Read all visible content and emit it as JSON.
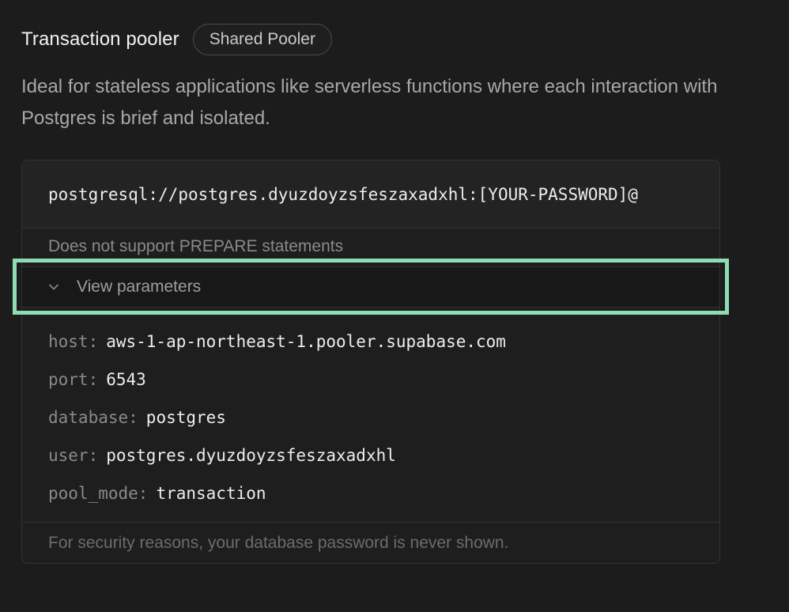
{
  "header": {
    "title": "Transaction pooler",
    "badge": "Shared Pooler"
  },
  "description": "Ideal for stateless applications like serverless functions where each interaction with Postgres is brief and isolated.",
  "connection": {
    "string": "postgresql://postgres.dyuzdoyzsfeszaxadxhl:[YOUR-PASSWORD]@"
  },
  "note": "Does not support PREPARE statements",
  "params_toggle": {
    "label": "View parameters",
    "icon": "chevron-down-icon"
  },
  "params": [
    {
      "key": "host:",
      "value": "aws-1-ap-northeast-1.pooler.supabase.com"
    },
    {
      "key": "port:",
      "value": "6543"
    },
    {
      "key": "database:",
      "value": "postgres"
    },
    {
      "key": "user:",
      "value": "postgres.dyuzdoyzsfeszaxadxhl"
    },
    {
      "key": "pool_mode:",
      "value": "transaction"
    }
  ],
  "footer": "For security reasons, your database password is never shown.",
  "colors": {
    "background": "#1c1c1c",
    "highlight": "#8fdcb3"
  }
}
